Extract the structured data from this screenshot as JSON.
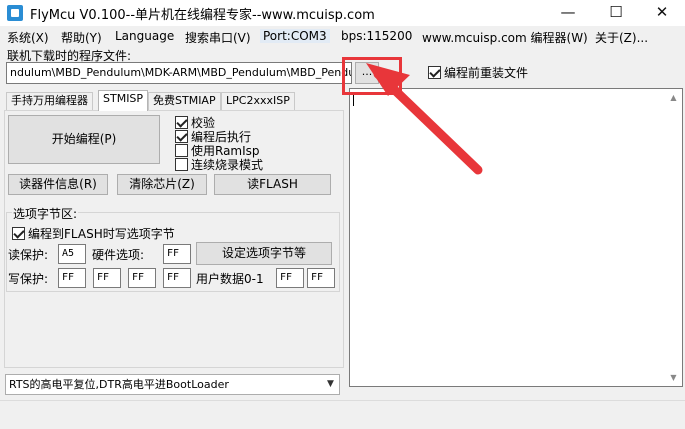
{
  "window": {
    "title": "FlyMcu V0.100--单片机在线编程专家--www.mcuisp.com",
    "minimize_glyph": "—",
    "maximize_glyph": "☐",
    "close_glyph": "✕"
  },
  "menu": {
    "items": [
      {
        "label": "系统(X)"
      },
      {
        "label": "帮助(Y)"
      },
      {
        "label": "Language"
      },
      {
        "label": "搜索串口(V)"
      },
      {
        "label": "Port:COM3"
      },
      {
        "label": "bps:115200"
      },
      {
        "label": "www.mcuisp.com 编程器(W)"
      },
      {
        "label": "关于(Z)..."
      }
    ]
  },
  "program_file": {
    "label": "联机下载时的程序文件:",
    "value": "ndulum\\MBD_Pendulum\\MDK-ARM\\MBD_Pendulum\\MBD_Pendulum.hex",
    "browse_label": "..."
  },
  "reload_before_program": {
    "label": "编程前重装文件",
    "checked": true
  },
  "tabs": [
    {
      "label": "手持万用编程器"
    },
    {
      "label": "STMISP",
      "active": true
    },
    {
      "label": "免费STMIAP"
    },
    {
      "label": "LPC2xxxISP"
    }
  ],
  "stmisp": {
    "start_label": "开始编程(P)",
    "options": [
      {
        "label": "校验",
        "checked": true
      },
      {
        "label": "编程后执行",
        "checked": true
      },
      {
        "label": "使用RamIsp",
        "checked": false
      },
      {
        "label": "连续烧录模式",
        "checked": false
      }
    ],
    "read_info_label": "读器件信息(R)",
    "erase_label": "清除芯片(Z)",
    "read_flash_label": "读FLASH",
    "option_bytes": {
      "title": "选项字节区:",
      "write_on_flash": {
        "label": "编程到FLASH时写选项字节",
        "checked": true
      },
      "read_protect_label": "读保护:",
      "read_protect_value": "A5",
      "hw_option_label": "硬件选项:",
      "hw_option_value": "FF",
      "set_button_label": "设定选项字节等",
      "write_protect_label": "写保护:",
      "write_protect_values": [
        "FF",
        "FF",
        "FF",
        "FF"
      ],
      "user_data_label": "用户数据0-1",
      "user_data_values": [
        "FF",
        "FF"
      ]
    },
    "boot_select": "RTS的高电平复位,DTR高电平进BootLoader"
  },
  "log": {
    "text": ""
  },
  "annotation": {
    "color": "#e8363a"
  }
}
